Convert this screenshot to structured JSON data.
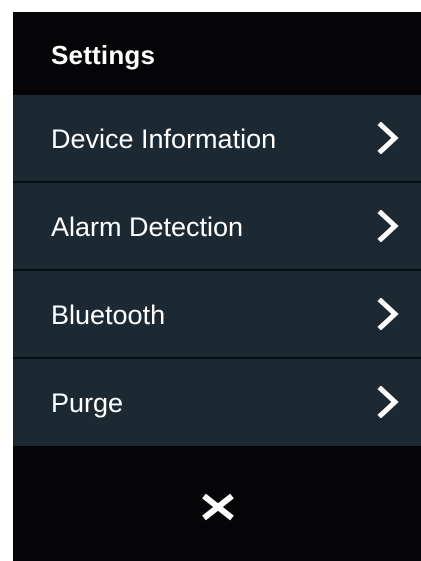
{
  "header": {
    "title": "Settings"
  },
  "menu": {
    "items": [
      {
        "label": "Device Information",
        "icon": "chevron-right-icon"
      },
      {
        "label": "Alarm Detection",
        "icon": "chevron-right-icon"
      },
      {
        "label": "Bluetooth",
        "icon": "chevron-right-icon"
      },
      {
        "label": "Purge",
        "icon": "chevron-right-icon"
      }
    ]
  },
  "footer": {
    "close_icon": "close-icon"
  },
  "colors": {
    "background": "#050507",
    "item_background": "#1c2933",
    "text": "#ffffff"
  }
}
